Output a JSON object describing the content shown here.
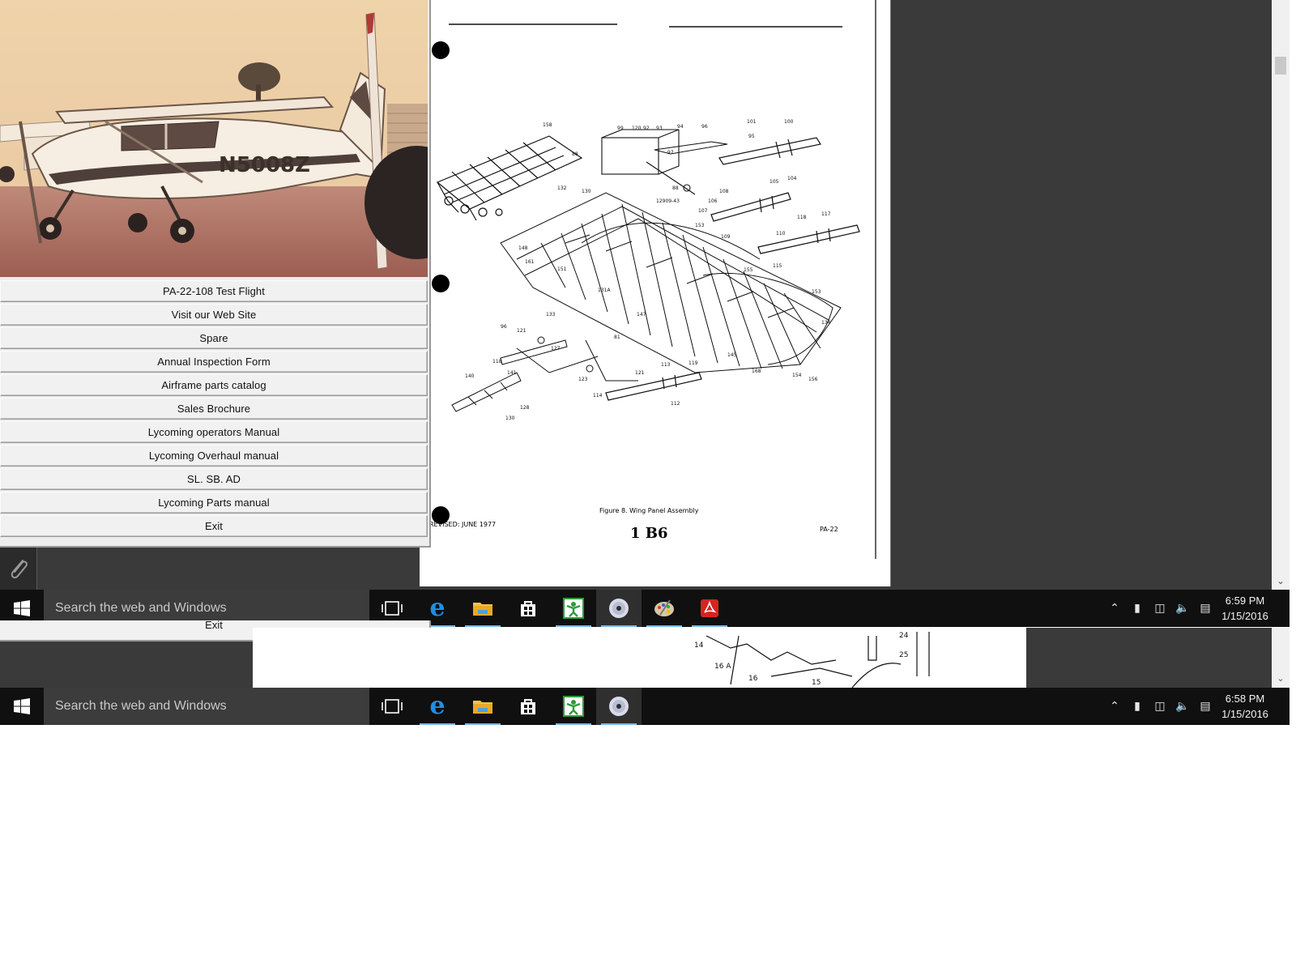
{
  "launcher": {
    "photo_registration": "N5008Z",
    "buttons": [
      "PA-22-108 Test Flight",
      "Visit our Web Site",
      "Spare",
      "Annual Inspection Form",
      "Airframe parts catalog",
      "Sales Brochure",
      "Lycoming operators Manual",
      "Lycoming Overhaul manual",
      "SL. SB. AD",
      "Lycoming Parts manual",
      "Exit"
    ],
    "ghost_label": "Exit"
  },
  "document": {
    "figure_caption": "Figure 8.  Wing Panel Assembly",
    "revised": "REVISED: JUNE 1977",
    "page_code": "1 B6",
    "model": "PA-22",
    "lower_callouts": [
      "14",
      "16 A",
      "16",
      "15",
      "24",
      "25"
    ]
  },
  "taskbar_front": {
    "search_placeholder": "Search the web and Windows",
    "time": "6:59 PM",
    "date": "1/15/2016"
  },
  "taskbar_back": {
    "search_placeholder": "Search the web and Windows",
    "time": "6:58 PM",
    "date": "1/15/2016"
  },
  "icons": {
    "start": "windows-logo-icon",
    "task_view": "task-view-icon",
    "edge": "edge-browser-icon",
    "explorer": "file-explorer-icon",
    "store": "store-icon",
    "app_green": "green-app-icon",
    "disc": "disc-app-icon",
    "paint": "paint-palette-icon",
    "acrobat": "acrobat-icon",
    "tray_chevron": "chevron-up-icon",
    "battery": "battery-icon",
    "network": "network-icon",
    "volume": "volume-icon",
    "action_center": "notification-icon",
    "attach": "paperclip-icon"
  },
  "colors": {
    "taskbar": "#101010",
    "search_box": "#3c3c3c",
    "desktop": "#3a3a3a",
    "accent": "#76b9ed"
  }
}
